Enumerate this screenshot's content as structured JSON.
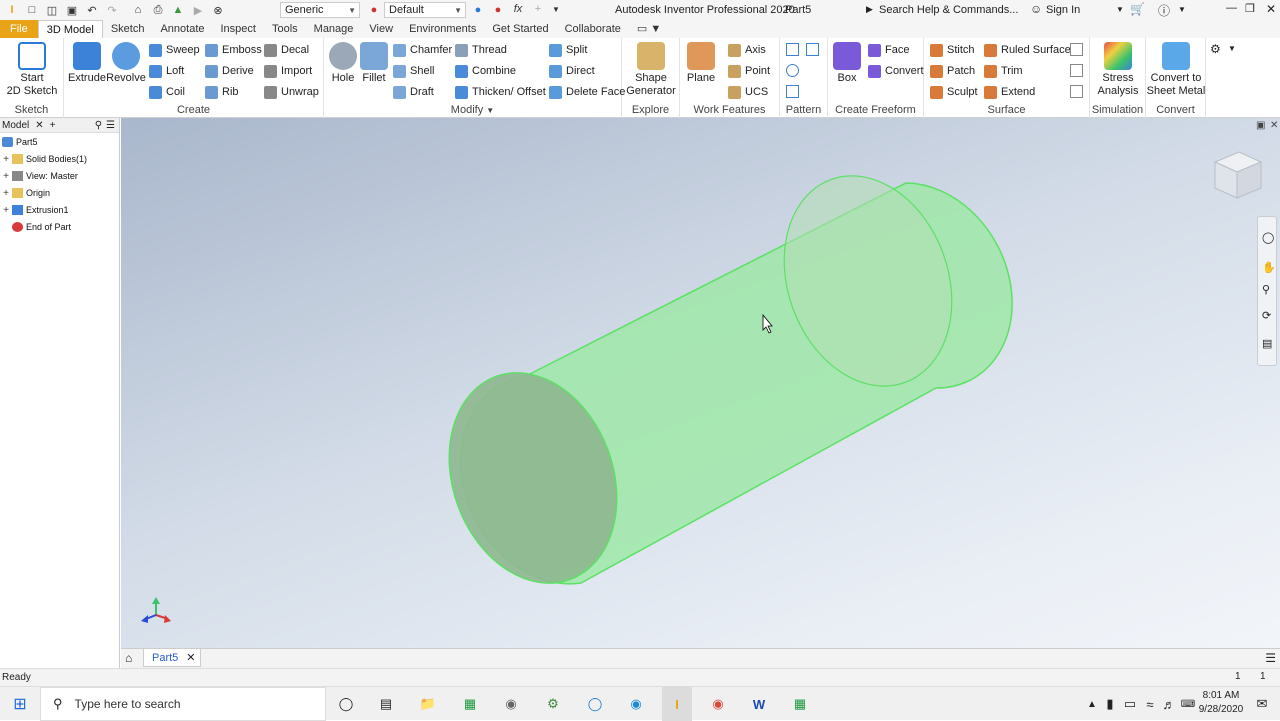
{
  "app": {
    "logo": "I",
    "title": "Autodesk Inventor Professional 2020",
    "document": "Part5",
    "search_placeholder": "Search Help & Commands...",
    "sign_in": "Sign In",
    "material": "Generic",
    "appearance": "Default"
  },
  "tabs": [
    "File",
    "3D Model",
    "Sketch",
    "Annotate",
    "Inspect",
    "Tools",
    "Manage",
    "View",
    "Environments",
    "Get Started",
    "Collaborate"
  ],
  "ribbon": {
    "sketch": {
      "start": "Start",
      "start2": "2D Sketch",
      "label": "Sketch"
    },
    "create": {
      "extrude": "Extrude",
      "revolve": "Revolve",
      "sweep": "Sweep",
      "loft": "Loft",
      "coil": "Coil",
      "emboss": "Emboss",
      "derive": "Derive",
      "rib": "Rib",
      "decal": "Decal",
      "import": "Import",
      "unwrap": "Unwrap",
      "label": "Create"
    },
    "modify": {
      "hole": "Hole",
      "fillet": "Fillet",
      "chamfer": "Chamfer",
      "shell": "Shell",
      "draft": "Draft",
      "thread": "Thread",
      "combine": "Combine",
      "thicken": "Thicken/ Offset",
      "split": "Split",
      "direct": "Direct",
      "delete_face": "Delete Face",
      "label": "Modify"
    },
    "explore": {
      "shape": "Shape",
      "shape2": "Generator",
      "label": "Explore"
    },
    "work": {
      "plane": "Plane",
      "axis": "Axis",
      "point": "Point",
      "ucs": "UCS",
      "label": "Work Features"
    },
    "pattern": {
      "label": "Pattern"
    },
    "freeform": {
      "box": "Box",
      "face": "Face",
      "convert": "Convert",
      "label": "Create Freeform"
    },
    "surface": {
      "stitch": "Stitch",
      "patch": "Patch",
      "sculpt": "Sculpt",
      "ruled": "Ruled Surface",
      "trim": "Trim",
      "extend": "Extend",
      "label": "Surface"
    },
    "simulation": {
      "stress": "Stress",
      "stress2": "Analysis",
      "label": "Simulation"
    },
    "convert": {
      "sheet": "Convert to",
      "sheet2": "Sheet Metal",
      "label": "Convert"
    }
  },
  "browser": {
    "title": "Model",
    "items": [
      {
        "label": "Part5",
        "icon": "part-icon",
        "indent": 0,
        "expand": ""
      },
      {
        "label": "Solid Bodies(1)",
        "icon": "folder-icon",
        "indent": 1,
        "expand": "+"
      },
      {
        "label": "View: Master",
        "icon": "view-icon",
        "indent": 1,
        "expand": "+"
      },
      {
        "label": "Origin",
        "icon": "folder-icon",
        "indent": 1,
        "expand": "+"
      },
      {
        "label": "Extrusion1",
        "icon": "extrusion-icon",
        "indent": 1,
        "expand": "+"
      },
      {
        "label": "End of Part",
        "icon": "end-of-part-icon",
        "indent": 1,
        "expand": ""
      }
    ]
  },
  "doc_tab": {
    "label": "Part5"
  },
  "status": {
    "text": "Ready",
    "count1": "1",
    "count2": "1"
  },
  "taskbar": {
    "search_placeholder": "Type here to search",
    "time": "8:01 AM",
    "date": "9/28/2020"
  },
  "colors": {
    "accent": "#e8a317",
    "selection": "#6ee07a",
    "viewport_top": "#a9b7cc",
    "viewport_bottom": "#f2f5f9"
  }
}
